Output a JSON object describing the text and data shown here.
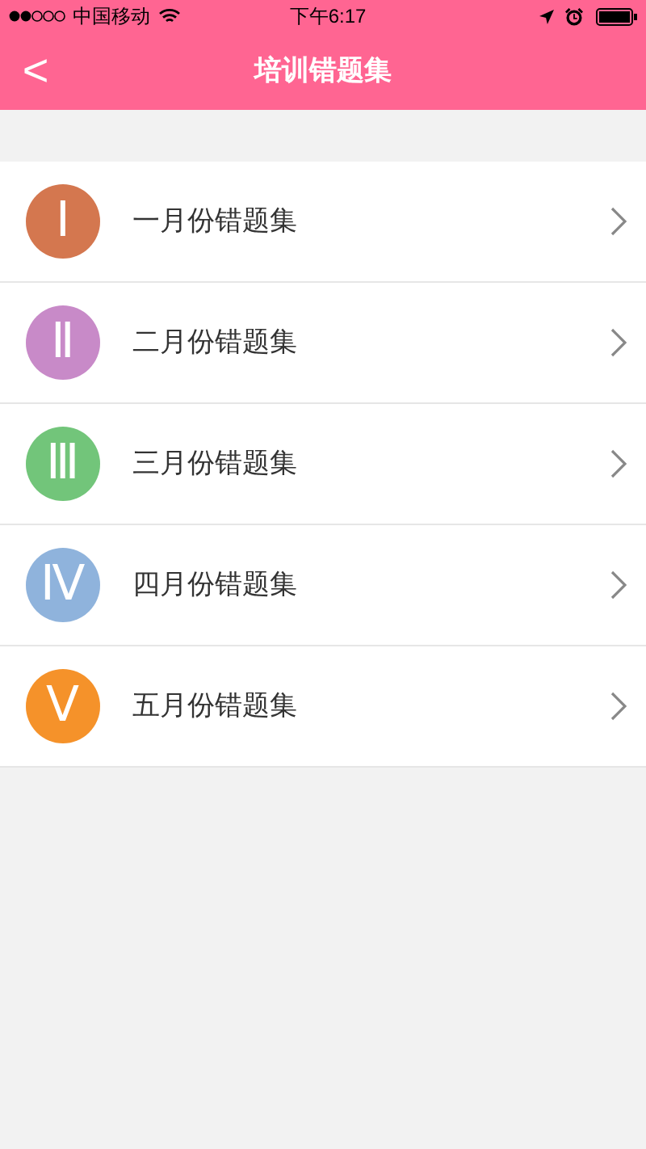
{
  "status_bar": {
    "carrier": "中国移动",
    "time": "下午6:17"
  },
  "nav": {
    "back": "<",
    "title": "培训错题集"
  },
  "items": [
    {
      "numeral": "Ⅰ",
      "label": "一月份错题集",
      "color": "#d4774f"
    },
    {
      "numeral": "Ⅱ",
      "label": "二月份错题集",
      "color": "#c88ac8"
    },
    {
      "numeral": "Ⅲ",
      "label": "三月份错题集",
      "color": "#72c57a"
    },
    {
      "numeral": "Ⅳ",
      "label": "四月份错题集",
      "color": "#8fb3dc"
    },
    {
      "numeral": "Ⅴ",
      "label": "五月份错题集",
      "color": "#f5922a"
    }
  ]
}
